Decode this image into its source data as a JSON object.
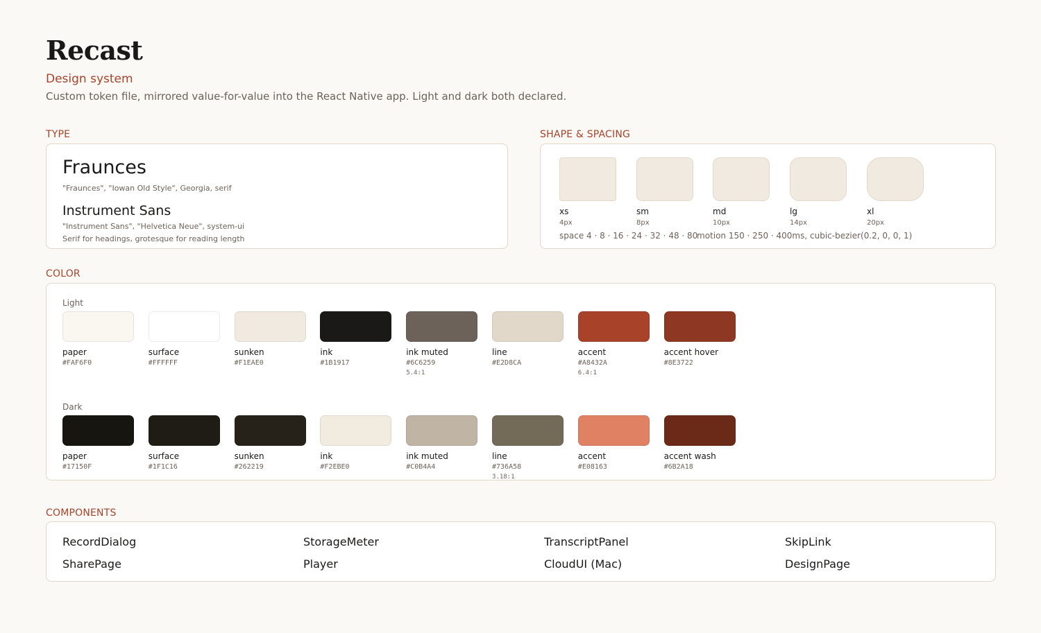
{
  "header": {
    "title": "Recast",
    "subtitle": "Design system",
    "description": "Custom token file, mirrored value-for-value into the React Native app. Light and dark both declared."
  },
  "type": {
    "label": "TYPE",
    "font1": {
      "name": "Fraunces",
      "stack": "\"Fraunces\", \"Iowan Old Style\", Georgia, serif"
    },
    "font2": {
      "name": "Instrument Sans",
      "stack": "\"Instrument Sans\", \"Helvetica Neue\", system-ui"
    },
    "note": "Serif for headings, grotesque for reading length"
  },
  "shape": {
    "label": "SHAPE & SPACING",
    "radii": [
      {
        "name": "xs",
        "value": "4px"
      },
      {
        "name": "sm",
        "value": "8px"
      },
      {
        "name": "md",
        "value": "10px"
      },
      {
        "name": "lg",
        "value": "14px"
      },
      {
        "name": "xl",
        "value": "20px"
      }
    ],
    "space": "space  4 · 8 · 16 · 24 · 32 · 48 · 80",
    "motion": "motion  150 · 250 · 400ms, cubic-bezier(0.2, 0, 0, 1)"
  },
  "color": {
    "label": "COLOR",
    "light": {
      "label": "Light",
      "swatches": [
        {
          "name": "paper",
          "hex": "#FAF6F0",
          "ratio": ""
        },
        {
          "name": "surface",
          "hex": "#FFFFFF",
          "ratio": ""
        },
        {
          "name": "sunken",
          "hex": "#F1EAE0",
          "ratio": ""
        },
        {
          "name": "ink",
          "hex": "#1B1917",
          "ratio": ""
        },
        {
          "name": "ink muted",
          "hex": "#6C6259",
          "ratio": "5.4:1"
        },
        {
          "name": "line",
          "hex": "#E2D8CA",
          "ratio": ""
        },
        {
          "name": "accent",
          "hex": "#A8432A",
          "ratio": "6.4:1"
        },
        {
          "name": "accent hover",
          "hex": "#8E3722",
          "ratio": ""
        }
      ]
    },
    "dark": {
      "label": "Dark",
      "swatches": [
        {
          "name": "paper",
          "hex": "#17150F",
          "ratio": ""
        },
        {
          "name": "surface",
          "hex": "#1F1C16",
          "ratio": ""
        },
        {
          "name": "sunken",
          "hex": "#262219",
          "ratio": ""
        },
        {
          "name": "ink",
          "hex": "#F2EBE0",
          "ratio": ""
        },
        {
          "name": "ink muted",
          "hex": "#C0B4A4",
          "ratio": ""
        },
        {
          "name": "line",
          "hex": "#736A58",
          "ratio": "3.18:1"
        },
        {
          "name": "accent",
          "hex": "#E08163",
          "ratio": ""
        },
        {
          "name": "accent wash",
          "hex": "#6B2A18",
          "ratio": ""
        }
      ]
    }
  },
  "components": {
    "label": "COMPONENTS",
    "items": [
      "RecordDialog",
      "StorageMeter",
      "TranscriptPanel",
      "SkipLink",
      "SharePage",
      "Player",
      "CloudUI (Mac)",
      "DesignPage"
    ]
  }
}
